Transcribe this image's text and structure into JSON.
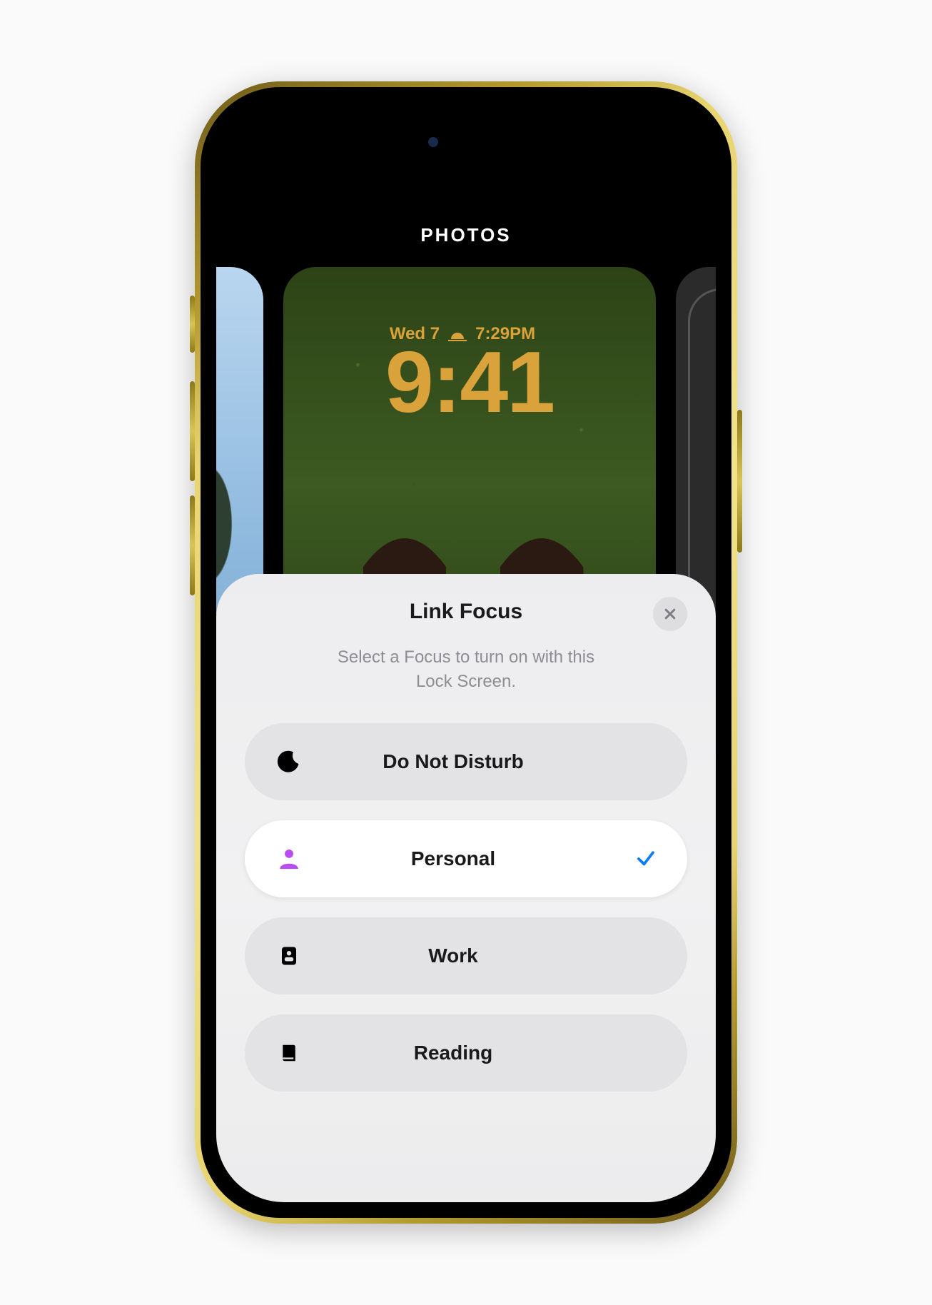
{
  "gallery": {
    "title": "PHOTOS"
  },
  "lockscreen": {
    "date": "Wed 7",
    "sunset": "7:29PM",
    "time": "9:41"
  },
  "sheet": {
    "title": "Link Focus",
    "description": "Select a Focus to turn on with this\nLock Screen.",
    "items": [
      {
        "label": "Do Not Disturb",
        "icon": "moon",
        "selected": false,
        "color": "#000000"
      },
      {
        "label": "Personal",
        "icon": "person",
        "selected": true,
        "color": "#b84df0"
      },
      {
        "label": "Work",
        "icon": "badge",
        "selected": false,
        "color": "#000000"
      },
      {
        "label": "Reading",
        "icon": "book",
        "selected": false,
        "color": "#000000"
      }
    ]
  }
}
